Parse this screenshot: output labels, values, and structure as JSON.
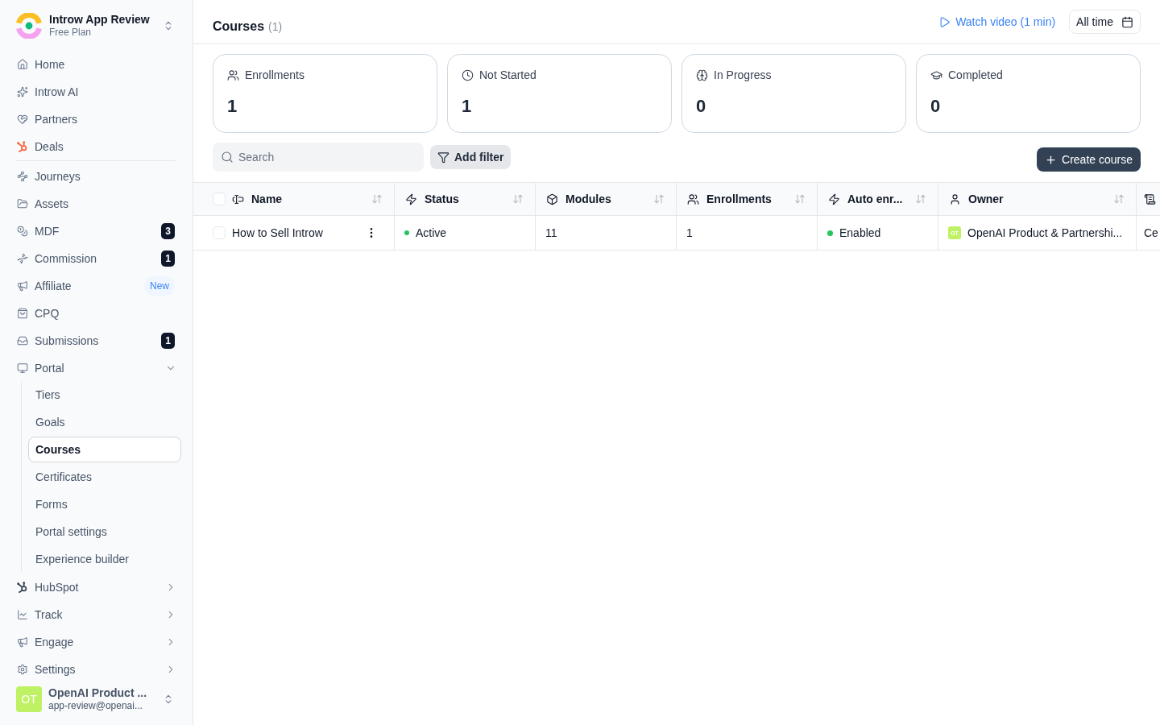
{
  "sidebar": {
    "workspace": {
      "name": "Introw App Review",
      "plan": "Free Plan"
    },
    "primary_items": [
      {
        "label": "Home",
        "selected": false
      },
      {
        "label": "Introw AI",
        "selected": false
      },
      {
        "label": "Partners",
        "selected": false
      },
      {
        "label": "Deals",
        "selected": false
      }
    ],
    "secondary_items": [
      {
        "label": "Journeys",
        "selected": false
      },
      {
        "label": "Assets",
        "selected": false
      },
      {
        "label": "MDF",
        "selected": false,
        "badge": {
          "kind": "count",
          "text": "3"
        }
      },
      {
        "label": "Commission",
        "selected": false,
        "badge": {
          "kind": "count",
          "text": "1"
        }
      },
      {
        "label": "Affiliate",
        "selected": false,
        "badge": {
          "kind": "new",
          "text": "New"
        }
      },
      {
        "label": "CPQ",
        "selected": false
      },
      {
        "label": "Submissions",
        "selected": false,
        "badge": {
          "kind": "count",
          "text": "1"
        }
      },
      {
        "label": "Portal",
        "selected": false,
        "expanded": true,
        "children": [
          {
            "label": "Tiers",
            "selected": false
          },
          {
            "label": "Goals",
            "selected": false
          },
          {
            "label": "Courses",
            "selected": true
          },
          {
            "label": "Certificates",
            "selected": false
          },
          {
            "label": "Forms",
            "selected": false
          },
          {
            "label": "Portal settings",
            "selected": false
          },
          {
            "label": "Experience builder",
            "selected": false
          }
        ]
      },
      {
        "label": "HubSpot",
        "selected": false,
        "expanded": false
      },
      {
        "label": "Track",
        "selected": false,
        "expanded": false
      },
      {
        "label": "Engage",
        "selected": false,
        "expanded": false
      },
      {
        "label": "Settings",
        "selected": false,
        "expanded": false
      }
    ],
    "user": {
      "initials": "OT",
      "name": "OpenAI Product ...",
      "email": "app-review@openai..."
    }
  },
  "header": {
    "title": "Courses",
    "count": "(1)",
    "video_link": "Watch video (1 min)",
    "date_range": "All time"
  },
  "stats": [
    {
      "label": "Enrollments",
      "value": "1"
    },
    {
      "label": "Not Started",
      "value": "1"
    },
    {
      "label": "In Progress",
      "value": "0"
    },
    {
      "label": "Completed",
      "value": "0"
    }
  ],
  "toolbar": {
    "search": {
      "placeholder": "Search"
    },
    "filter_button": "Add filter",
    "create_button": "Create course"
  },
  "table": {
    "select_all_checked": false,
    "columns": [
      {
        "kind": "sortable",
        "label": "Name"
      },
      {
        "kind": "sortable",
        "label": "Status"
      },
      {
        "kind": "sortable",
        "label": "Modules"
      },
      {
        "kind": "sortable",
        "label": "Enrollments"
      },
      {
        "kind": "sortable",
        "label": "Auto enr..."
      },
      {
        "kind": "sortable",
        "label": "Owner"
      },
      {
        "kind": "cut"
      }
    ],
    "rows": [
      {
        "checked": false,
        "name": "How to Sell Introw",
        "status": {
          "text": "Active",
          "color": "#22c55e"
        },
        "modules": "11",
        "enrollments": "1",
        "auto_enroll": {
          "text": "Enabled",
          "color": "#22c55e"
        },
        "owner": {
          "initials": "OT",
          "name": "OpenAI Product & Partnershi..."
        },
        "column_7": "Ce"
      }
    ]
  }
}
